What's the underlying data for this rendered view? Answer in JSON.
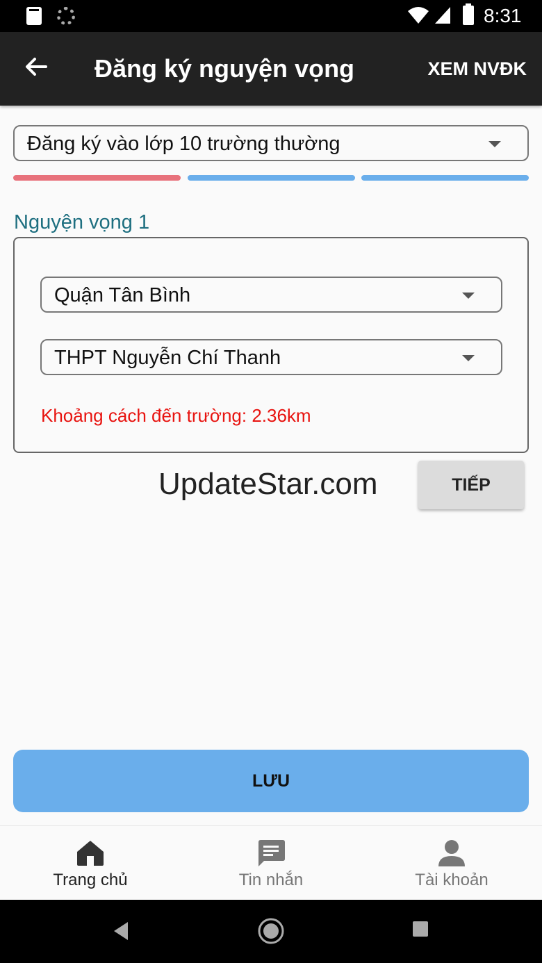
{
  "status_bar": {
    "time": "8:31",
    "icons": [
      "sd-card-icon",
      "spinner-icon",
      "wifi-icon",
      "signal-icon",
      "battery-icon"
    ]
  },
  "app_bar": {
    "title": "Đăng ký nguyện vọng",
    "action": "XEM NVĐK",
    "back_icon": "back-arrow-icon"
  },
  "registration_type": {
    "selected": "Đăng ký vào lớp 10 trường thường"
  },
  "steps": {
    "total": 3,
    "current": 1,
    "colors": {
      "active": "#e8727c",
      "inactive": "#6aaeeb"
    }
  },
  "wish": {
    "label": "Nguyện vọng 1",
    "district": "Quận Tân Bình",
    "school": "THPT Nguyễn Chí Thanh",
    "distance": "Khoảng cách đến trường: 2.36km"
  },
  "watermark": "UpdateStar.com",
  "buttons": {
    "next": "TIẾP",
    "save": "LƯU"
  },
  "bottom_nav": {
    "items": [
      {
        "label": "Trang chủ",
        "icon": "home-icon",
        "active": true
      },
      {
        "label": "Tin nhắn",
        "icon": "message-icon",
        "active": false
      },
      {
        "label": "Tài khoản",
        "icon": "account-icon",
        "active": false
      }
    ]
  },
  "colors": {
    "app_bar": "#222222",
    "accent_label": "#1e6f80",
    "distance_text": "#e8130f",
    "save_button": "#6aaeeb"
  }
}
